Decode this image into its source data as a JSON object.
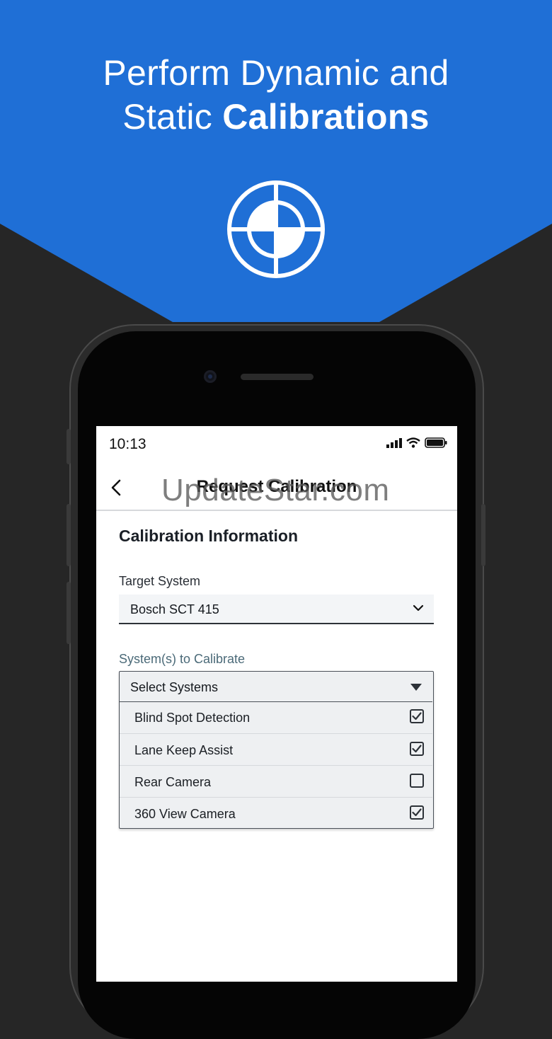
{
  "banner": {
    "line1": "Perform Dynamic and",
    "line2_regular": "Static ",
    "line2_bold": "Calibrations",
    "bg_color": "#1f6fd6",
    "icon": "calibration-target-icon"
  },
  "status_bar": {
    "time": "10:13",
    "icons": [
      "signal-icon",
      "wifi-icon",
      "battery-icon"
    ]
  },
  "nav": {
    "back_icon": "chevron-left-icon",
    "title": "Request Calibration"
  },
  "watermark": "UpdateStar.com",
  "form": {
    "section_title": "Calibration Information",
    "target_system": {
      "label": "Target System",
      "value": "Bosch SCT 415",
      "icon": "chevron-down-icon"
    },
    "systems": {
      "label": "System(s) to Calibrate",
      "placeholder": "Select Systems",
      "icon": "triangle-down-icon",
      "options": [
        {
          "label": "Blind Spot Detection",
          "checked": true
        },
        {
          "label": "Lane Keep Assist",
          "checked": true
        },
        {
          "label": "Rear Camera",
          "checked": false
        },
        {
          "label": "360 View Camera",
          "checked": true
        }
      ]
    }
  }
}
